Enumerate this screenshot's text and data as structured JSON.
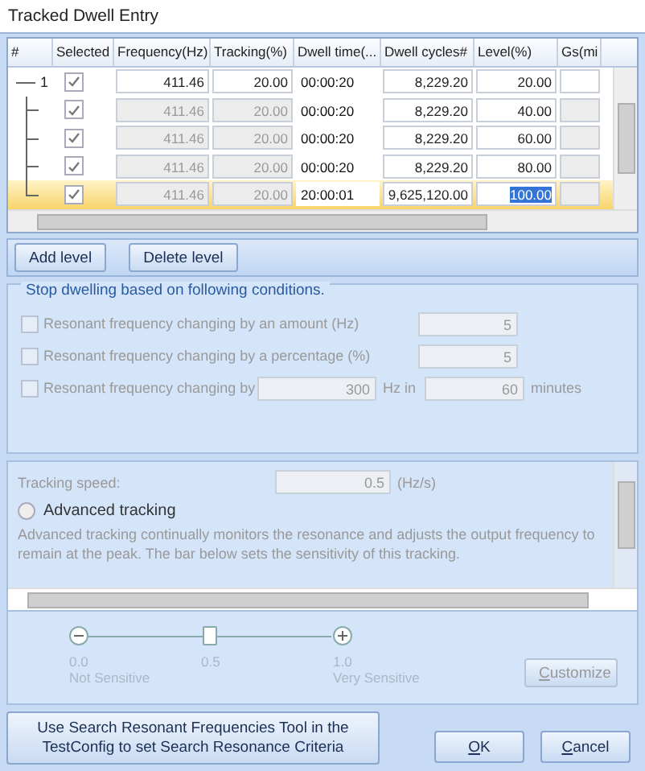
{
  "window": {
    "title": "Tracked Dwell Entry"
  },
  "grid": {
    "columns": [
      "#",
      "Selected",
      "Frequency(Hz)",
      "Tracking(%)",
      "Dwell time(...",
      "Dwell cycles#",
      "Level(%)",
      "Gs(mi"
    ],
    "rows": [
      {
        "label": "1",
        "checked": true,
        "selected": false,
        "locked": false,
        "frequency": "411.46",
        "tracking": "20.00",
        "dwell_time": "00:00:20",
        "dwell_cycles": "8,229.20",
        "level": "20.00",
        "level_highlighted": false,
        "children": [
          {
            "checked": true,
            "selected": false,
            "locked": true,
            "frequency": "411.46",
            "tracking": "20.00",
            "dwell_time": "00:00:20",
            "dwell_cycles": "8,229.20",
            "level": "40.00",
            "level_highlighted": false
          },
          {
            "checked": true,
            "selected": false,
            "locked": true,
            "frequency": "411.46",
            "tracking": "20.00",
            "dwell_time": "00:00:20",
            "dwell_cycles": "8,229.20",
            "level": "60.00",
            "level_highlighted": false
          },
          {
            "checked": true,
            "selected": false,
            "locked": true,
            "frequency": "411.46",
            "tracking": "20.00",
            "dwell_time": "00:00:20",
            "dwell_cycles": "8,229.20",
            "level": "80.00",
            "level_highlighted": false
          },
          {
            "checked": true,
            "selected": true,
            "locked": true,
            "frequency": "411.46",
            "tracking": "20.00",
            "dwell_time": "20:00:01",
            "dwell_cycles": "9,625,120.00",
            "level": "100.00",
            "level_highlighted": true
          }
        ]
      }
    ]
  },
  "toolbar": {
    "buttons": [
      "Add level",
      "Delete level"
    ]
  },
  "conditions": {
    "title": "Stop dwelling based on following conditions.",
    "items": [
      {
        "kind": "single",
        "label": "Resonant frequency changing by an amount (Hz)",
        "checked": false,
        "value": "5"
      },
      {
        "kind": "single",
        "label": "Resonant frequency changing by a percentage (%)",
        "checked": false,
        "value": "5"
      },
      {
        "kind": "range",
        "label": "Resonant frequency changing by",
        "checked": false,
        "value": "300",
        "unit": "Hz in",
        "value2": "60",
        "unit2": "minutes"
      }
    ]
  },
  "tracking": {
    "speed_label": "Tracking speed:",
    "speed_value": "0.5",
    "speed_unit": "(Hz/s)",
    "advanced": {
      "label": "Advanced tracking",
      "selected": false
    },
    "description": "Advanced tracking continually monitors the resonance and adjusts the output frequency to remain at the peak. The bar below sets the sensitivity of this tracking."
  },
  "sensitivity": {
    "level": 0.5,
    "ticks": [
      {
        "value": "0.0",
        "caption": "Not Sensitive"
      },
      {
        "value": "0.5"
      },
      {
        "value": "1.0",
        "caption": "Very Sensitive"
      }
    ],
    "customize_button": "Customize"
  },
  "footer": {
    "info_button": "Use Search Resonant Frequencies Tool in the TestConfig to set Search Resonance Criteria",
    "ok_button": "OK",
    "cancel_button": "Cancel"
  }
}
